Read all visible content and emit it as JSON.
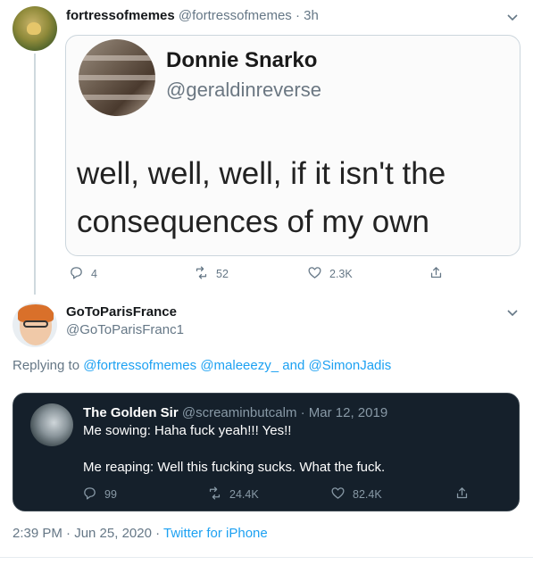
{
  "top_tweet": {
    "name": "fortressofmemes",
    "handle": "@fortressofmemes",
    "time": "· 3h",
    "image": {
      "name": "Donnie Snarko",
      "handle": "@geraldinreverse",
      "text_line1": "well, well, well, if it isn't the",
      "text_line2": "consequences of my own actions"
    },
    "actions": {
      "replies": "4",
      "retweets": "52",
      "likes": "2.3K"
    },
    "icons": [
      "reply-icon",
      "retweet-icon",
      "like-icon",
      "share-icon",
      "chevron-down-icon"
    ]
  },
  "reply": {
    "name": "GoToParisFrance",
    "handle": "@GoToParisFranc1",
    "replying_prefix": "Replying to",
    "mention1": "@fortressofmemes",
    "mention2": "@maleeezy_",
    "and_word": "and",
    "mention3": "@SimonJadis",
    "quote": {
      "name": "The Golden Sir",
      "handle_time": "@screaminbutcalm · Mar 12, 2019",
      "line1": "Me sowing: Haha fuck yeah!!! Yes!!",
      "line2": "Me reaping: Well this fucking sucks. What the fuck.",
      "replies": "99",
      "retweets": "24.4K",
      "likes": "82.4K"
    }
  },
  "timestamp": {
    "time": "2:39 PM · Jun 25, 2020 · ",
    "source": "Twitter for iPhone"
  },
  "colors": {
    "link": "#1da1f2",
    "muted": "#657786",
    "dark_card": "#15202b"
  }
}
